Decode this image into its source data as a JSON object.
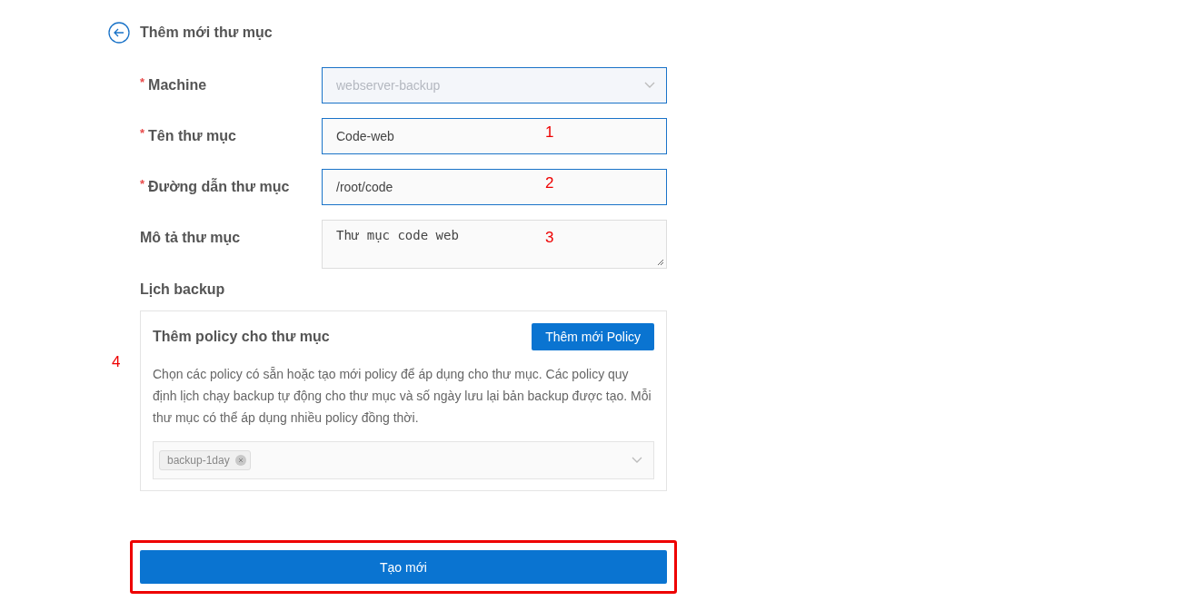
{
  "header": {
    "title": "Thêm mới thư mục"
  },
  "fields": [
    {
      "kind": "select",
      "label": "Machine",
      "required_mark": "*",
      "disabled": true,
      "value": "webserver-backup"
    },
    {
      "kind": "input",
      "label": "Tên thư mục",
      "required_mark": "*",
      "value": "Code-web",
      "annotation": "1"
    },
    {
      "kind": "input",
      "label": "Đường dẫn thư mục",
      "required_mark": "*",
      "value": "/root/code",
      "annotation": "2"
    },
    {
      "kind": "textarea",
      "label": "Mô tả thư mục",
      "value": "Thư mục code web",
      "annotation": "3"
    }
  ],
  "schedule": {
    "label": "Lịch backup",
    "panel": {
      "title": "Thêm policy cho thư mục",
      "button": "Thêm mới Policy",
      "description": "Chọn các policy có sẵn hoặc tạo mới policy để áp dụng cho thư mục. Các policy quy định lịch chạy backup tự động cho thư mục và số ngày lưu lại bản backup được tạo. Mỗi thư mục có thể áp dụng nhiều policy đồng thời.",
      "tags": [
        "backup-1day"
      ]
    },
    "annotation": "4"
  },
  "submit": {
    "label": "Tạo mới",
    "highlighted": true
  }
}
